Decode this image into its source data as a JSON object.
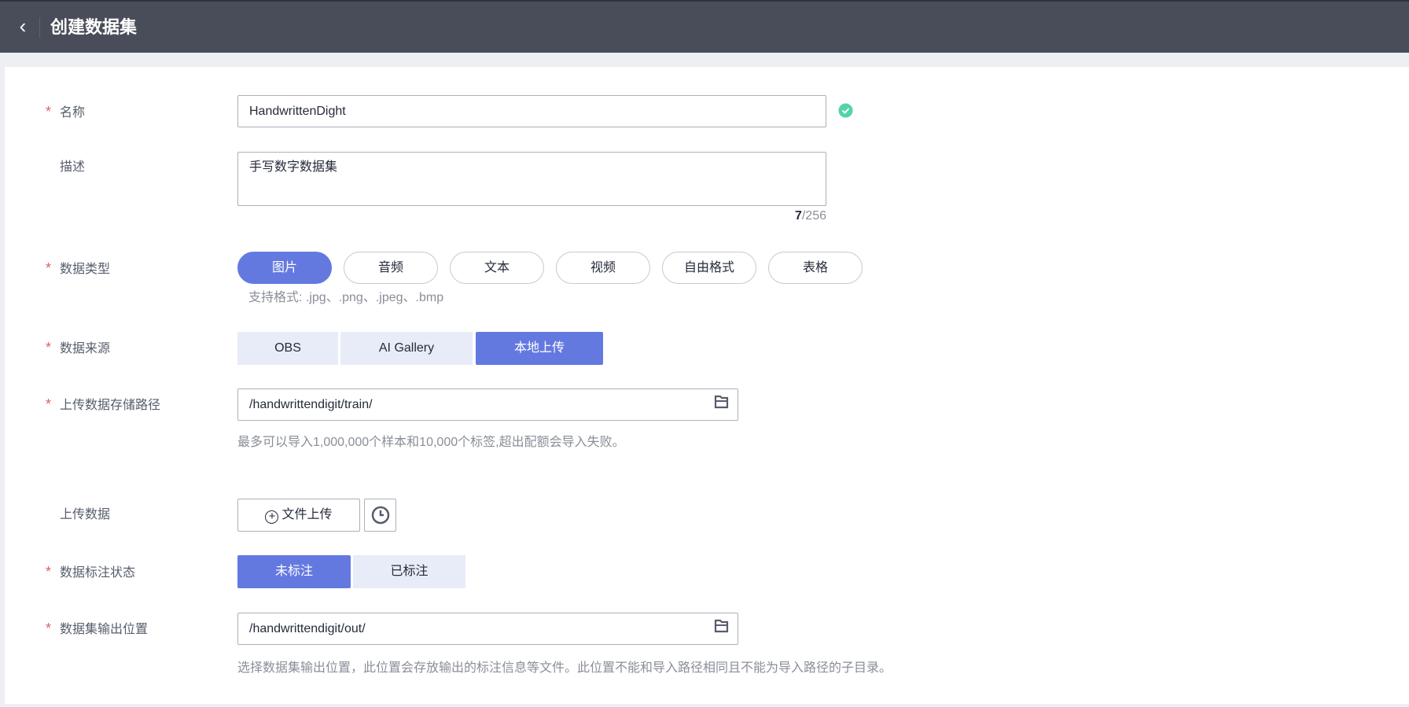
{
  "header": {
    "title": "创建数据集"
  },
  "form": {
    "name": {
      "label": "名称",
      "value": "HandwrittenDight"
    },
    "description": {
      "label": "描述",
      "value": "手写数字数据集",
      "count": "7",
      "max": "/256"
    },
    "data_type": {
      "label": "数据类型",
      "options": [
        "图片",
        "音频",
        "文本",
        "视频",
        "自由格式",
        "表格"
      ],
      "hint": "支持格式: .jpg、.png、.jpeg、.bmp"
    },
    "data_source": {
      "label": "数据来源",
      "options": [
        "OBS",
        "AI Gallery",
        "本地上传"
      ]
    },
    "upload_path": {
      "label": "上传数据存储路径",
      "value": "/handwrittendigit/train/",
      "hint": "最多可以导入1,000,000个样本和10,000个标签,超出配额会导入失败。"
    },
    "upload_data": {
      "label": "上传数据",
      "button": "文件上传"
    },
    "label_status": {
      "label": "数据标注状态",
      "options": [
        "未标注",
        "已标注"
      ]
    },
    "output_path": {
      "label": "数据集输出位置",
      "value": "/handwrittendigit/out/",
      "hint": "选择数据集输出位置，此位置会存放输出的标注信息等文件。此位置不能和导入路径相同且不能为导入路径的子目录。"
    }
  },
  "colors": {
    "accent": "#6479e0",
    "header": "#484d59",
    "success": "#50d4ab",
    "required": "#e0615f"
  }
}
